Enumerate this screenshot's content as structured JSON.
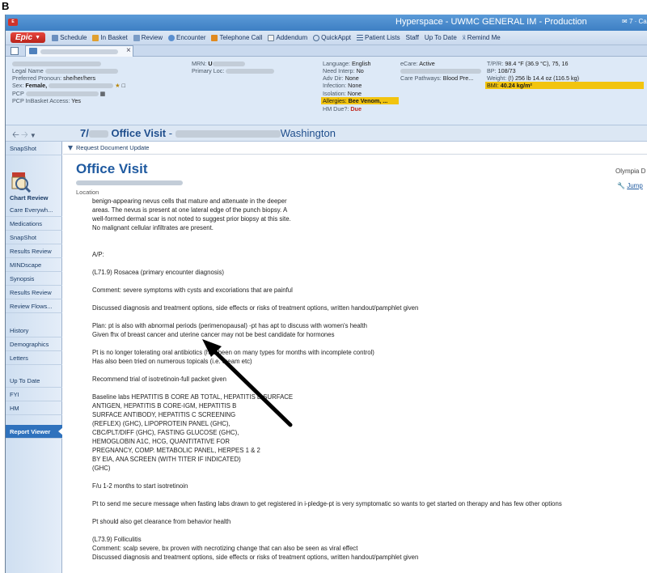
{
  "figure_label": "B",
  "window": {
    "title": "Hyperspace - UWMC GENERAL IM - Production",
    "alert_text": "7 · Can"
  },
  "toolbar": {
    "epic_label": "Epic",
    "items": [
      {
        "label": "Schedule",
        "icon": "calendar-icon"
      },
      {
        "label": "In Basket",
        "icon": "inbox-icon"
      },
      {
        "label": "Review",
        "icon": "review-icon"
      },
      {
        "label": "Encounter",
        "icon": "encounter-icon"
      },
      {
        "label": "Telephone Call",
        "icon": "phone-icon"
      },
      {
        "label": "Addendum",
        "icon": "document-icon"
      },
      {
        "label": "QuickAppt",
        "icon": "clock-icon"
      },
      {
        "label": "Patient Lists",
        "icon": "list-icon"
      },
      {
        "label": "Staff",
        "icon": ""
      },
      {
        "label": "Up To Date",
        "icon": ""
      },
      {
        "label": "Remind Me",
        "icon": "bell-icon"
      }
    ]
  },
  "patient": {
    "col1": {
      "legal_name_label": "Legal Name",
      "pronoun_label": "Preferred Pronoun:",
      "pronoun_value": "she/her/hers",
      "sex_label": "Sex:",
      "sex_value": "Female,",
      "pcp_label": "PCP",
      "pcp_inbasket_label": "PCP InBasket Access:",
      "pcp_inbasket_value": "Yes"
    },
    "col2": {
      "mrn_label": "MRN:",
      "mrn_value": "U",
      "primary_loc_label": "Primary Loc:"
    },
    "col3": {
      "language_label": "Language:",
      "language_value": "English",
      "interp_label": "Need Interp:",
      "interp_value": "No",
      "advdir_label": "Adv Dir:",
      "advdir_value": "None",
      "infection_label": "Infection:",
      "infection_value": "None",
      "isolation_label": "Isolation:",
      "isolation_value": "None",
      "allergies_label": "Allergies:",
      "allergies_value": "Bee Venom, ...",
      "hmdue_label": "HM Due?:",
      "hmdue_value": "Due"
    },
    "col4": {
      "ecare_label": "eCare:",
      "ecare_value": "Active",
      "pathways_label": "Care Pathways:",
      "pathways_value": "Blood Pre..."
    },
    "col5": {
      "tpr_label": "T/P/R:",
      "tpr_value": "98.4 °F (36.9 °C), 75, 16",
      "bp_label": "BP:",
      "bp_value": "108/73",
      "weight_label": "Weight:",
      "weight_value": "(!) 256 lb 14.4 oz (116.5 kg)",
      "bmi_label": "BMI:",
      "bmi_value": "40.24 kg/m²"
    }
  },
  "navbar": {
    "visit_prefix": "7/",
    "visit_title": "Office Visit",
    "visit_dash": "-",
    "visit_suffix": "Washington"
  },
  "sidebar": {
    "snapshot_top": "SnapShot",
    "chart_review": "Chart Review",
    "items": [
      "Care Everywh...",
      "Medications",
      "SnapShot",
      "Results Review",
      "MINDscape",
      "Synopsis",
      "Results Review",
      "Review Flows...",
      "History",
      "Demographics",
      "Letters",
      "Up To Date",
      "FYI",
      "HM",
      "Report Viewer"
    ],
    "active_item": "Report Viewer"
  },
  "content": {
    "request_update": "Request Document Update",
    "title": "Office Visit",
    "location_label": "Location",
    "provider_partial": "Olympia D",
    "jump_label": "Jump",
    "note_lines": [
      "benign-appearing nevus cells that mature and attenuate in the deeper",
      "areas.  The nevus is present at one lateral edge of the punch biopsy.  A",
      "well-formed dermal scar is not noted to suggest prior biopsy at this site.",
      " No malignant cellular infiltrates are present.",
      "",
      "",
      "A/P:",
      "",
      "(L71.9) Rosacea (primary encounter diagnosis)",
      "",
      "Comment: severe symptoms with cysts and excoriations that are painful",
      "",
      "Discussed diagnosis and treatment options, side effects or risks of treatment options, written handout/pamphlet given",
      "",
      "Plan: pt is also with abnormal periods (perimenopausal) -pt has apt to discuss with women's health",
      "Given fhx of breast cancer and uterine cancer may not be best candidate for hormones",
      "",
      "Pt is no longer tolerating oral antibiotics (has been on many types for months with incomplete control)",
      "Has also been tried on numerous topicals (i.e. cream etc)",
      "",
      "Recommend trial of isotretinoin-full packet given",
      "",
      "Baseline labs HEPATITIS B CORE AB TOTAL, HEPATITIS B SURFACE",
      "ANTIGEN, HEPATITIS B CORE-IGM, HEPATITIS B",
      "SURFACE ANTIBODY, HEPATITIS C SCREENING",
      "(REFLEX) (GHC), LIPOPROTEIN PANEL (GHC),",
      "CBC/PLT/DIFF (GHC), FASTING GLUCOSE (GHC),",
      "HEMOGLOBIN A1C, HCG, QUANTITATIVE FOR",
      "PREGNANCY, COMP. METABOLIC PANEL, HERPES 1 & 2",
      "BY EIA, ANA SCREEN (WITH TITER IF INDICATED)",
      "(GHC)",
      "",
      "F/u 1-2 months to start isotretinoin",
      "",
      "Pt to send me secure message when fasting labs drawn to get registered in i-pledge-pt is very symptomatic so wants to get started on therapy and has few other options",
      "",
      "Pt should also get clearance from behavior health",
      "",
      "(L73.9) Folliculitis",
      "Comment: scalp severe, bx proven with necrotizing change that can also be seen as viral effect",
      "Discussed diagnosis and treatment options, side effects or risks of treatment options, written handout/pamphlet given"
    ]
  },
  "colors": {
    "titlebar": "#3e7fc4",
    "epic_red": "#d0332c",
    "highlight_yellow": "#f2c40f",
    "accent_blue": "#1f5aa0",
    "active_nav": "#2f72bd"
  }
}
